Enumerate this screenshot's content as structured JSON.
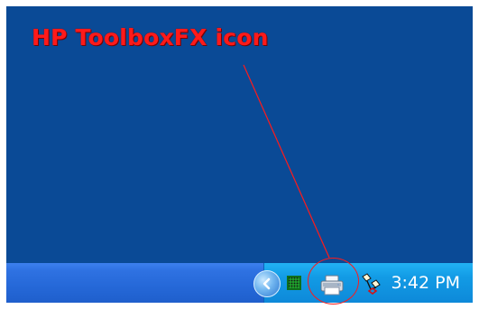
{
  "annotation": {
    "label": "HP ToolboxFX icon"
  },
  "desktop": {
    "background_color": "#0a4a96"
  },
  "taskbar": {
    "color": "#2568d8"
  },
  "tray": {
    "color": "#129be5",
    "icons": {
      "show_hidden": "chevron-left-icon",
      "monitor": "monitor-icon",
      "hp_toolbox": "printer-icon",
      "network": "network-icon"
    },
    "clock": {
      "time": "3:42 PM"
    }
  }
}
